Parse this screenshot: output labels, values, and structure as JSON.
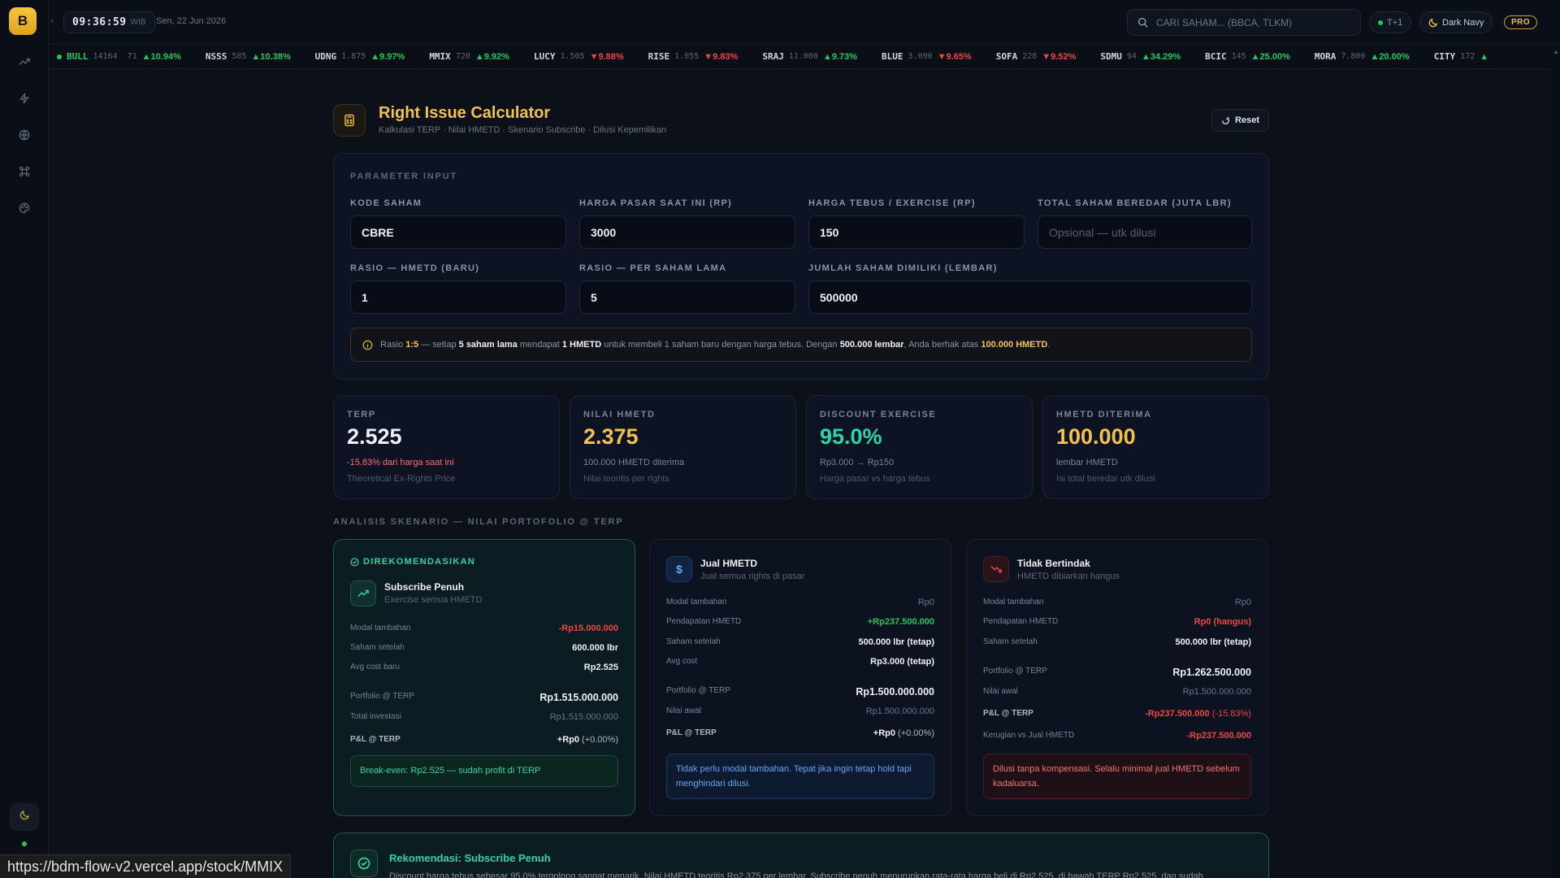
{
  "sidebar": {
    "logo": "B",
    "icons": [
      "trend-icon",
      "bolt-icon",
      "globe-icon",
      "command-icon",
      "palette-icon"
    ],
    "bottom_icon": "moon-icon"
  },
  "topbar": {
    "time": "09:36:59",
    "tz": "WIB",
    "date": "Sen, 22 Jun 2026",
    "search_placeholder": "CARI SAHAM... (BBCA, TLKM)",
    "settlement": "T+1",
    "theme": "Dark Navy",
    "plan": "PRO"
  },
  "ticker": {
    "market": {
      "label": "BULL",
      "value": "14164"
    },
    "items": [
      {
        "symbol": "",
        "price": "71",
        "change": "▲10.94%",
        "dir": "up"
      },
      {
        "symbol": "NSSS",
        "price": "585",
        "change": "▲10.38%",
        "dir": "up"
      },
      {
        "symbol": "UDNG",
        "price": "1.875",
        "change": "▲9.97%",
        "dir": "up"
      },
      {
        "symbol": "MMIX",
        "price": "720",
        "change": "▲9.92%",
        "dir": "up"
      },
      {
        "symbol": "LUCY",
        "price": "1.505",
        "change": "▼9.88%",
        "dir": "down"
      },
      {
        "symbol": "RISE",
        "price": "1.055",
        "change": "▼9.83%",
        "dir": "down"
      },
      {
        "symbol": "SRAJ",
        "price": "11.000",
        "change": "▲9.73%",
        "dir": "up"
      },
      {
        "symbol": "BLUE",
        "price": "3.090",
        "change": "▼9.65%",
        "dir": "down"
      },
      {
        "symbol": "SOFA",
        "price": "228",
        "change": "▼9.52%",
        "dir": "down"
      },
      {
        "symbol": "SDMU",
        "price": "94",
        "change": "▲34.29%",
        "dir": "up"
      },
      {
        "symbol": "BCIC",
        "price": "145",
        "change": "▲25.00%",
        "dir": "up"
      },
      {
        "symbol": "MORA",
        "price": "7.800",
        "change": "▲20.00%",
        "dir": "up"
      },
      {
        "symbol": "CITY",
        "price": "172",
        "change": "▲",
        "dir": "up"
      }
    ]
  },
  "page": {
    "title": "Right Issue Calculator",
    "subtitle": "Kalkulasi TERP · Nilai HMETD · Skenario Subscribe · Dilusi Kepemilikan",
    "reset_label": "Reset"
  },
  "params": {
    "section": "PARAMETER INPUT",
    "kode_saham": {
      "label": "KODE SAHAM",
      "value": "CBRE"
    },
    "harga_pasar": {
      "label": "HARGA PASAR SAAT INI (RP)",
      "value": "3000"
    },
    "harga_tebus": {
      "label": "HARGA TEBUS / EXERCISE (RP)",
      "value": "150"
    },
    "total_saham": {
      "label": "TOTAL SAHAM BEREDAR (JUTA LBR)",
      "value": "",
      "placeholder": "Opsional — utk dilusi"
    },
    "rasio_baru": {
      "label": "RASIO — HMETD (BARU)",
      "value": "1"
    },
    "rasio_lama": {
      "label": "RASIO — PER SAHAM LAMA",
      "value": "5"
    },
    "jumlah_saham": {
      "label": "JUMLAH SAHAM DIMILIKI (LEMBAR)",
      "value": "500000"
    },
    "info": {
      "t1": "Rasio",
      "ratio": "1:5",
      "t2": "— setiap",
      "b1": "5 saham lama",
      "t3": "mendapat",
      "b2": "1 HMETD",
      "t4": "untuk membeli 1 saham baru dengan harga tebus. Dengan",
      "b3": "500.000 lembar",
      "t5": ", Anda berhak atas",
      "gold2": "100.000 HMETD",
      "t6": "."
    }
  },
  "metrics": [
    {
      "label": "TERP",
      "value": "2.525",
      "sub": "-15.83% dari harga saat ini",
      "desc": "Theoretical Ex-Rights Price",
      "value_color": "#eef1f5",
      "sub_color": "#f87171"
    },
    {
      "label": "NILAI HMETD",
      "value": "2.375",
      "sub": "100.000 HMETD diterima",
      "desc": "Nilai teoritis per rights",
      "value_color": "#f2c14e",
      "sub_color": "#7a8494"
    },
    {
      "label": "DISCOUNT EXERCISE",
      "value": "95.0%",
      "sub": "Rp3.000 → Rp150",
      "desc": "Harga pasar vs harga tebus",
      "value_color": "#2dd4a5",
      "sub_color": "#7a8494"
    },
    {
      "label": "HMETD DITERIMA",
      "value": "100.000",
      "sub": "lembar HMETD",
      "desc": "Isi total beredar utk dilusi",
      "value_color": "#f2c14e",
      "sub_color": "#7a8494"
    }
  ],
  "scenario_title": "ANALISIS SKENARIO — NILAI PORTOFOLIO @ TERP",
  "scenarios": {
    "subscribe": {
      "badge": "DIREKOMENDASIKAN",
      "name": "Subscribe Penuh",
      "desc": "Exercise semua HMETD",
      "rows": [
        {
          "k": "Modal tambahan",
          "v": "-Rp15.000.000"
        },
        {
          "k": "Saham setelah",
          "v": "600.000 lbr"
        },
        {
          "k": "Avg cost baru",
          "v": "Rp2.525"
        },
        {
          "k": "Portfolio @ TERP",
          "v": "Rp1.515.000.000"
        },
        {
          "k": "Total investasi",
          "v": "Rp1.515.000.000"
        },
        {
          "k": "P&L @ TERP",
          "v": "+Rp0",
          "pct": "(+0.00%)"
        }
      ],
      "note": "Break-even: Rp2.525 — sudah profit di TERP"
    },
    "jual": {
      "name": "Jual HMETD",
      "desc": "Jual semua rights di pasar",
      "rows": [
        {
          "k": "Modal tambahan",
          "v": "Rp0"
        },
        {
          "k": "Pendapatan HMETD",
          "v": "+Rp237.500.000"
        },
        {
          "k": "Saham setelah",
          "v": "500.000 lbr (tetap)"
        },
        {
          "k": "Avg cost",
          "v": "Rp3.000 (tetap)"
        },
        {
          "k": "Portfolio @ TERP",
          "v": "Rp1.500.000.000"
        },
        {
          "k": "Nilai awal",
          "v": "Rp1.500.000.000"
        },
        {
          "k": "P&L @ TERP",
          "v": "+Rp0",
          "pct": "(+0.00%)"
        }
      ],
      "note": "Tidak perlu modal tambahan. Tepat jika ingin tetap hold tapi menghindari dilusi."
    },
    "tidak": {
      "name": "Tidak Bertindak",
      "desc": "HMETD dibiarkan hangus",
      "rows": [
        {
          "k": "Modal tambahan",
          "v": "Rp0"
        },
        {
          "k": "Pendapatan HMETD",
          "v": "Rp0 (hangus)"
        },
        {
          "k": "Saham setelah",
          "v": "500.000 lbr (tetap)"
        },
        {
          "k": "Portfolio @ TERP",
          "v": "Rp1.262.500.000"
        },
        {
          "k": "Nilai awal",
          "v": "Rp1.500.000.000"
        },
        {
          "k": "P&L @ TERP",
          "v": "-Rp237.500.000",
          "pct": "(-15.83%)"
        },
        {
          "k": "Kerugian vs Jual HMETD",
          "v": "-Rp237.500.000"
        }
      ],
      "note": "Dilusi tanpa kompensasi. Selalu minimal jual HMETD sebelum kadaluarsa."
    }
  },
  "recommendation": {
    "title": "Rekomendasi: Subscribe Penuh",
    "text": "Discount harga tebus sebesar 95.0% tergolong sangat menarik. Nilai HMETD teoritis Rp2.375 per lembar. Subscribe penuh menurunkan rata-rata harga beli di Rp2.525, di bawah TERP Rp2.525, dan sudah"
  },
  "status_url": "https://bdm-flow-v2.vercel.app/stock/MMIX"
}
